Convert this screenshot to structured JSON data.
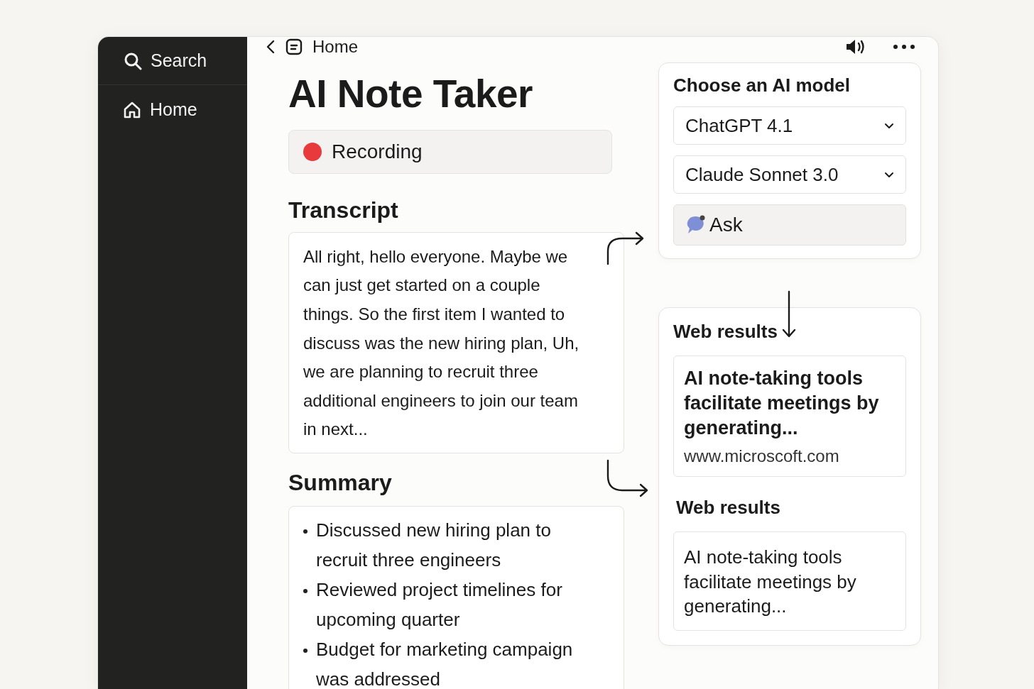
{
  "sidebar": {
    "search": {
      "label": "Search"
    },
    "items": [
      {
        "label": "Home"
      }
    ]
  },
  "breadcrumb": {
    "label": "Home"
  },
  "page": {
    "title": "AI Note Taker",
    "recording": {
      "label": "Recording",
      "active": true
    },
    "transcript": {
      "heading": "Transcript",
      "text": "All right, hello everyone. Maybe we can just get started on a couple things. So the first item I wanted to discuss was the new hiring plan, Uh, we are planning to recruit three additional engineers to join our team in next..."
    },
    "summary": {
      "heading": "Summary",
      "items": [
        "Discussed new hiring plan to recruit three engineers",
        "Reviewed project timelines for upcoming quarter",
        "Budget for marketing campaign was addressed"
      ]
    }
  },
  "model_panel": {
    "heading": "Choose an AI model",
    "dropdowns": [
      {
        "value": "ChatGPT 4.1"
      },
      {
        "value": "Claude Sonnet 3.0"
      }
    ],
    "ask_button": {
      "label": "Ask"
    }
  },
  "web_results": [
    {
      "heading": "Web results",
      "kind": "featured",
      "title": "AI note-taking tools facilitate meetings by generating...",
      "url": "www.microscoft.com"
    },
    {
      "heading": "Web results",
      "kind": "plain",
      "title": "AI note-taking tools facilitate meetings by generating..."
    }
  ]
}
